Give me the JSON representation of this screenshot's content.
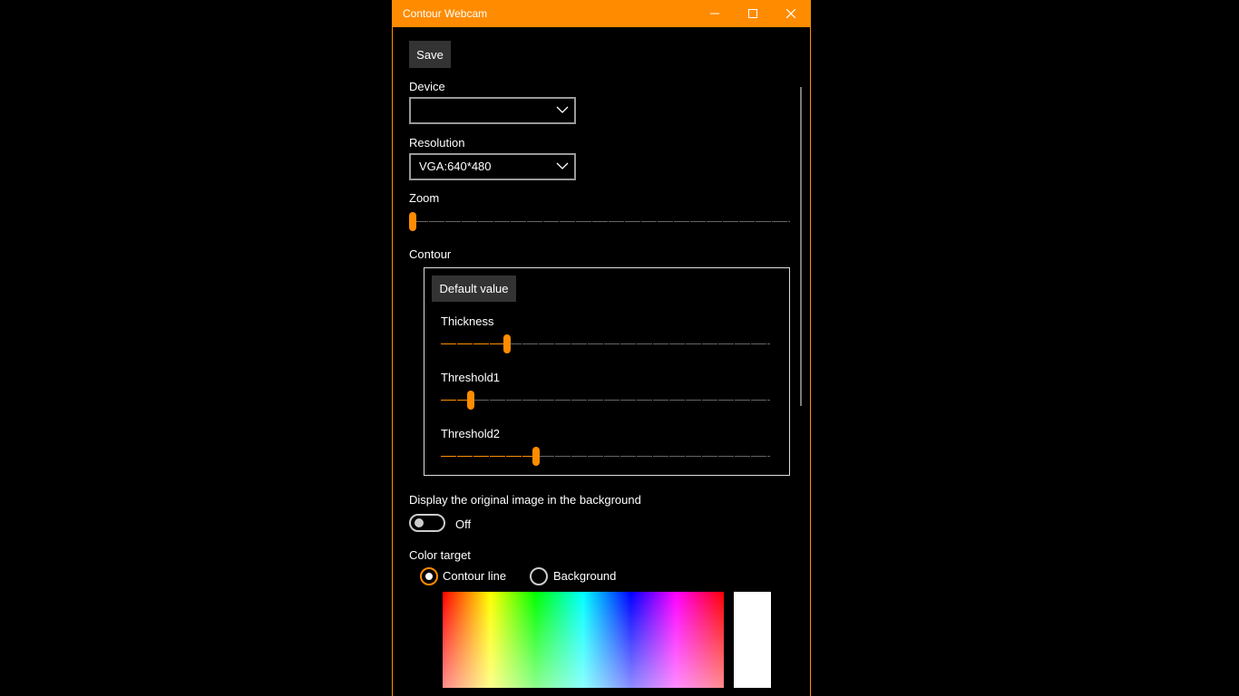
{
  "window": {
    "title": "Contour Webcam"
  },
  "toolbar": {
    "save_label": "Save"
  },
  "device": {
    "label": "Device",
    "value": ""
  },
  "resolution": {
    "label": "Resolution",
    "value": "VGA:640*480"
  },
  "zoom": {
    "label": "Zoom",
    "value_fraction": 0.0
  },
  "contour": {
    "label": "Contour",
    "default_button": "Default value",
    "thickness": {
      "label": "Thickness",
      "value_fraction": 0.2
    },
    "threshold1": {
      "label": "Threshold1",
      "value_fraction": 0.09
    },
    "threshold2": {
      "label": "Threshold2",
      "value_fraction": 0.29
    }
  },
  "background_toggle": {
    "label": "Display the original image in the background",
    "state": "Off"
  },
  "color_target": {
    "label": "Color target",
    "options": [
      "Contour line",
      "Background"
    ],
    "selected": "Contour line"
  },
  "colors": {
    "accent": "#ff8c00",
    "preview": "#ffffff"
  }
}
